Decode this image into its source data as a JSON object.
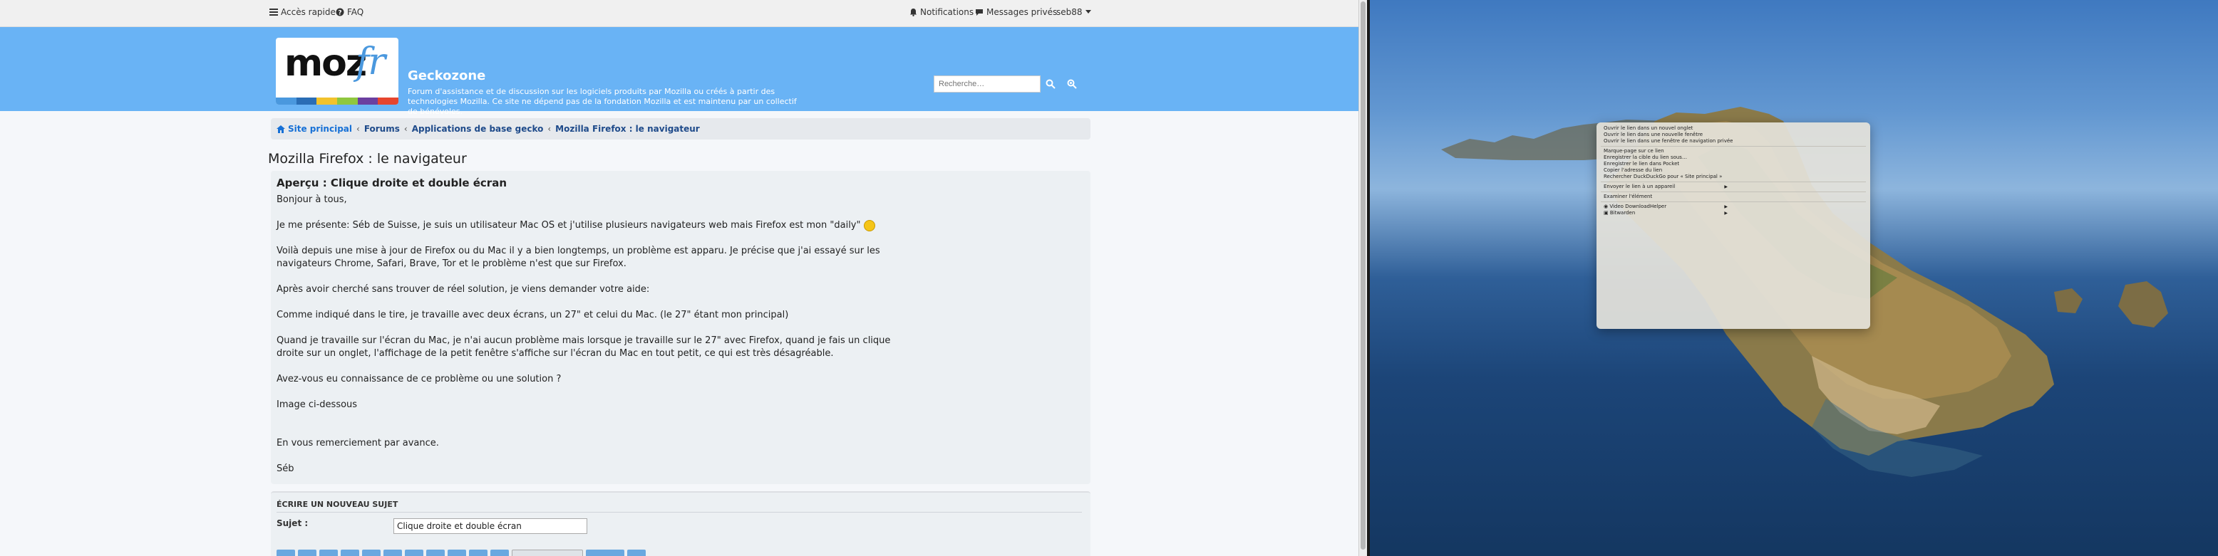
{
  "topbar": {
    "quick_access": "Accès rapide",
    "faq": "FAQ",
    "notifications": "Notifications",
    "private_messages": "Messages privés",
    "username": "seb88"
  },
  "header": {
    "logo_main": "moz",
    "logo_accent": "fr",
    "site_name": "Geckozone",
    "site_description": "Forum d'assistance et de discussion sur les logiciels produits par Mozilla ou créés à partir des technologies Mozilla. Ce site ne dépend pas de la fondation Mozilla et est maintenu par un collectif de bénévoles.",
    "search_placeholder": "Recherche…",
    "stripe_colors": [
      "#4a98de",
      "#2a6db5",
      "#f2c22c",
      "#8fc73e",
      "#6b3fa0",
      "#e6452e"
    ]
  },
  "breadcrumb": {
    "home": "Site principal",
    "items": [
      "Forums",
      "Applications de base gecko",
      "Mozilla Firefox : le navigateur"
    ]
  },
  "page": {
    "title": "Mozilla Firefox : le navigateur"
  },
  "post": {
    "title": "Aperçu : Clique droite et double écran",
    "greeting": "Bonjour à tous,",
    "p1": "Je me présente: Séb de Suisse, je suis un utilisateur Mac OS et j'utilise plusieurs navigateurs web mais Firefox est mon \"daily\"",
    "p2_line1": "Voilà depuis une mise à jour de Firefox ou du Mac il y a bien longtemps, un problème est apparu. Je précise que j'ai essayé sur les",
    "p2_line2": "navigateurs Chrome, Safari, Brave, Tor et le problème n'est que sur Firefox.",
    "p3": "Après avoir cherché sans trouver de réel solution, je viens demander votre aide:",
    "p4": "Comme indiqué dans le tire, je travaille avec deux écrans, un 27\" et celui du Mac. (le 27\" étant mon principal)",
    "p5_line1": "Quand je travaille sur l'écran du Mac, je n'ai aucun problème mais lorsque je travaille sur le 27\" avec Firefox, quand je fais un clique",
    "p5_line2": "droite sur un onglet, l'affichage de la petit fenêtre s'affiche sur l'écran du Mac en tout petit, ce qui est très désagréable.",
    "p6": "Avez-vous eu connaissance de ce problème ou une solution ?",
    "p7": "Image ci-dessous",
    "p8": "En vous remerciement par avance.",
    "signature": "Séb"
  },
  "reply": {
    "heading": "Écrire un nouveau sujet",
    "subject_label": "Sujet :",
    "subject_value": "Clique droite et double écran"
  },
  "context_menu": {
    "group1": [
      "Ouvrir le lien dans un nouvel onglet",
      "Ouvrir le lien dans une nouvelle fenêtre",
      "Ouvrir le lien dans une fenêtre de navigation privée"
    ],
    "group2": [
      "Marque-page sur ce lien",
      "Enregistrer la cible du lien sous…",
      "Enregistrer le lien dans Pocket",
      "Copier l'adresse du lien",
      "Rechercher DuckDuckGo pour « Site principal »"
    ],
    "group3": [
      "Envoyer le lien à un appareil"
    ],
    "group4": [
      "Examiner l'élément"
    ],
    "group5": [
      "Video DownloadHelper",
      "Bitwarden"
    ]
  }
}
